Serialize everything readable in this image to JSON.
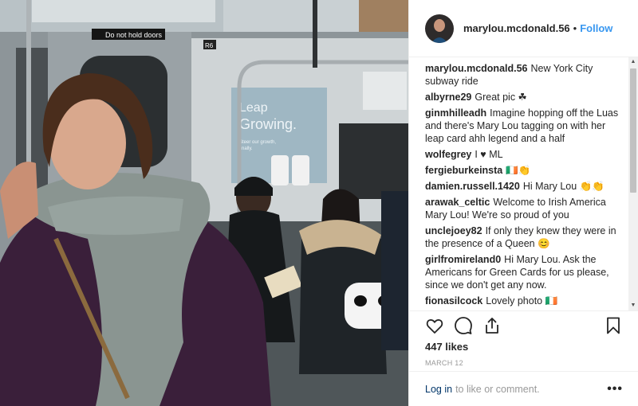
{
  "header": {
    "username": "marylou.mcdonald.56",
    "separator": "•",
    "follow_label": "Follow"
  },
  "photo": {
    "sign_text": "Do not hold doors",
    "car_number": "R6",
    "poster_line1": "Leap",
    "poster_line2": "Growing.",
    "poster_line3": "Steer our growth,",
    "poster_line4": "finally."
  },
  "caption": {
    "username": "marylou.mcdonald.56",
    "text": "New York City subway ride"
  },
  "comments": [
    {
      "username": "albyrne29",
      "text": "Great pic ☘"
    },
    {
      "username": "ginmhilleadh",
      "text": "Imagine hopping off the Luas and there's Mary Lou tagging on with her leap card ahh legend and a half"
    },
    {
      "username": "wolfegrey",
      "text": "I ♥ ML"
    },
    {
      "username": "fergieburkeinsta",
      "text": "🇮🇪👏"
    },
    {
      "username": "damien.russell.1420",
      "text": "Hi Mary Lou 👏👏"
    },
    {
      "username": "arawak_celtic",
      "text": "Welcome to Irish America Mary Lou! We're so proud of you"
    },
    {
      "username": "unclejoey82",
      "text": "If only they knew they were in the presence of a Queen 😊"
    },
    {
      "username": "girlfromireland0",
      "text": "Hi Mary Lou. Ask the Americans for Green Cards for us please, since we don't get any now."
    },
    {
      "username": "fionasilcock",
      "text": "Lovely photo 🇮🇪"
    }
  ],
  "likes": "447 likes",
  "date": "MARCH 12",
  "login": {
    "link_label": "Log in",
    "rest_text": "to like or comment.",
    "more_label": "•••"
  },
  "icons": {
    "like": "heart-icon",
    "comment": "speech-bubble-icon",
    "share": "share-icon",
    "save": "bookmark-icon",
    "scroll_up": "scroll-up-arrow-icon",
    "scroll_down": "scroll-down-arrow-icon"
  },
  "colors": {
    "follow": "#3897f0",
    "link": "#003569",
    "muted": "#999999",
    "text": "#262626"
  }
}
